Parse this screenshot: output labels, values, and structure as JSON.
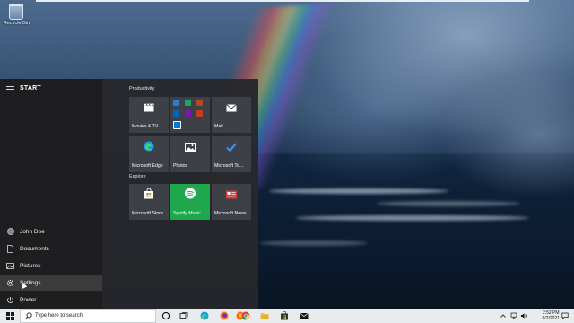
{
  "desktop": {
    "icons": [
      {
        "label": "Recycle Bin",
        "icon": "recycle-bin-icon"
      }
    ]
  },
  "start_menu": {
    "title": "START",
    "nav": [
      {
        "label": "John Doe",
        "icon": "user-avatar-icon"
      },
      {
        "label": "Documents",
        "icon": "document-icon"
      },
      {
        "label": "Pictures",
        "icon": "pictures-icon"
      },
      {
        "label": "Settings",
        "icon": "gear-icon",
        "hovered": true
      },
      {
        "label": "Power",
        "icon": "power-icon"
      }
    ],
    "groups": [
      {
        "label": "Productivity",
        "tiles": [
          {
            "label": "Movies & TV",
            "icon": "clapperboard-icon"
          },
          {
            "label": "",
            "icon": "office-apps-folder-icon"
          },
          {
            "label": "Mail",
            "icon": "mail-icon"
          },
          {
            "label": "Microsoft Edge",
            "icon": "edge-icon"
          },
          {
            "label": "Photos",
            "icon": "photos-icon"
          },
          {
            "label": "Microsoft To...",
            "icon": "checkmark-icon"
          }
        ]
      },
      {
        "label": "Explore",
        "tiles": [
          {
            "label": "Microsoft Store",
            "icon": "store-bag-icon"
          },
          {
            "label": "Spotify Music",
            "icon": "spotify-icon",
            "color": "#1fa74e"
          },
          {
            "label": "Microsoft News",
            "icon": "news-icon"
          }
        ]
      }
    ]
  },
  "taskbar": {
    "search_placeholder": "Type here to search",
    "pinned": [
      "cortana-circle-icon",
      "task-view-icon",
      "edge-icon",
      "firefox-icon",
      "firefox-icon",
      "chrome-icon",
      "file-explorer-icon",
      "store-icon",
      "mail-icon"
    ],
    "clock": {
      "time": "2:52 PM",
      "date": "6/2/2021"
    },
    "colors": {
      "accent": "#0078d7",
      "taskbar_bg": "#e9ecef"
    }
  }
}
